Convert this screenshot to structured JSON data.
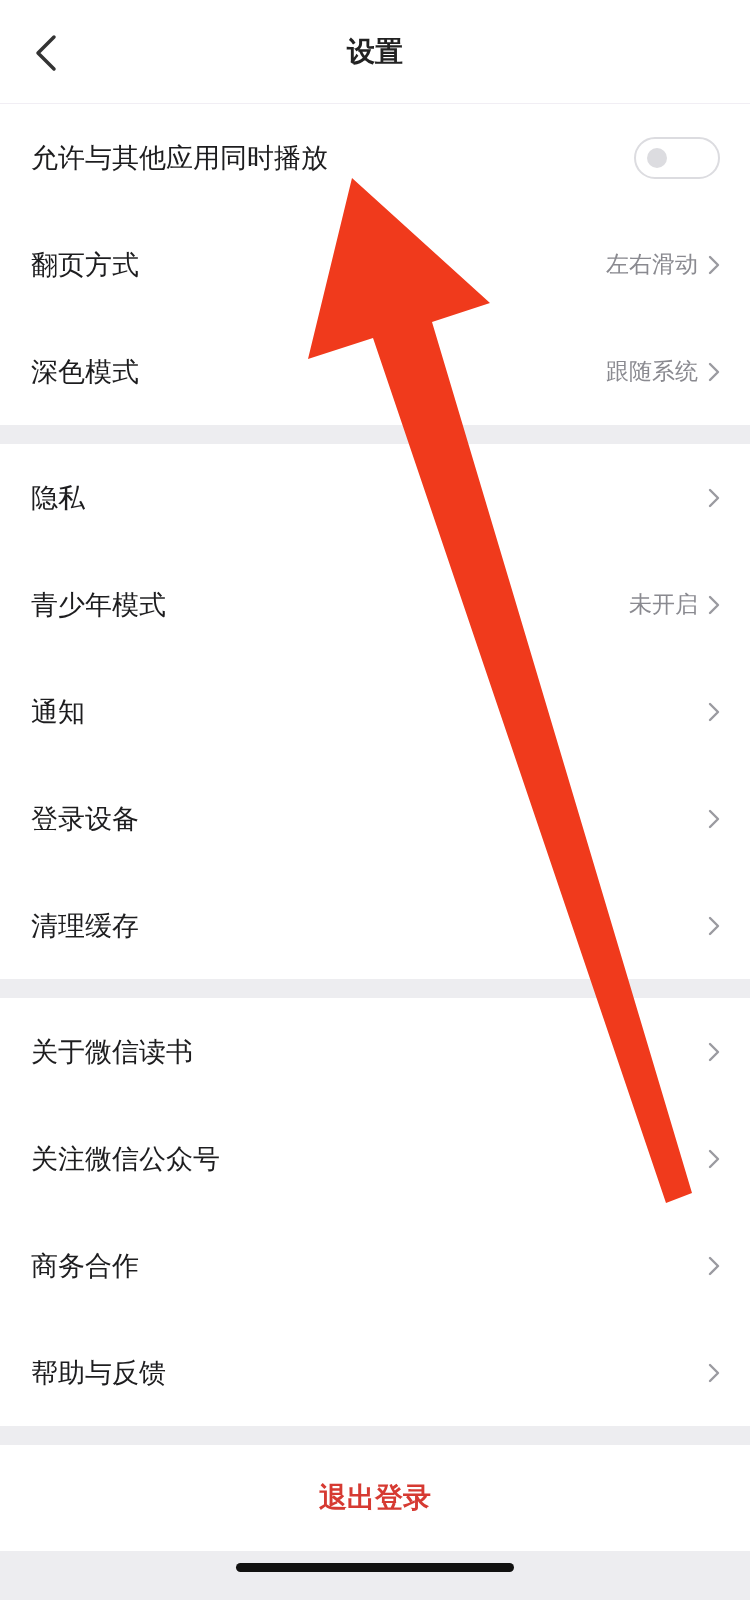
{
  "header": {
    "title": "设置"
  },
  "sections": [
    {
      "rows": [
        {
          "kind": "toggle",
          "label": "允许与其他应用同时播放",
          "on": false
        },
        {
          "kind": "link",
          "label": "翻页方式",
          "value": "左右滑动"
        },
        {
          "kind": "link",
          "label": "深色模式",
          "value": "跟随系统"
        }
      ]
    },
    {
      "rows": [
        {
          "kind": "link",
          "label": "隐私"
        },
        {
          "kind": "link",
          "label": "青少年模式",
          "value": "未开启"
        },
        {
          "kind": "link",
          "label": "通知"
        },
        {
          "kind": "link",
          "label": "登录设备"
        },
        {
          "kind": "link",
          "label": "清理缓存"
        }
      ]
    },
    {
      "rows": [
        {
          "kind": "link",
          "label": "关于微信读书"
        },
        {
          "kind": "link",
          "label": "关注微信公众号"
        },
        {
          "kind": "link",
          "label": "商务合作"
        },
        {
          "kind": "link",
          "label": "帮助与反馈"
        }
      ]
    }
  ],
  "logout_button": "退出登录"
}
